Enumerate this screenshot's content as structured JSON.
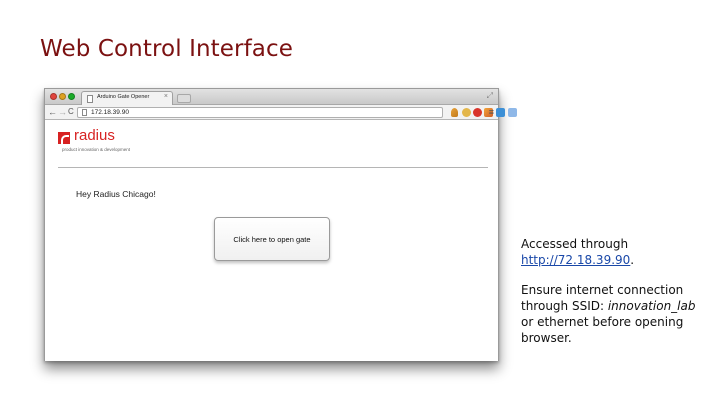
{
  "slide": {
    "title": "Web Control Interface"
  },
  "browser": {
    "tab_title": "Arduino Gate Opener",
    "tab_close": "×",
    "url": "172.18.39.90",
    "nav_back": "←",
    "nav_forward": "→",
    "nav_reload": "C",
    "menu": "≡",
    "expand": "⤢"
  },
  "page": {
    "logo_name": "radius",
    "logo_tagline": "product innovation & development",
    "greeting": "Hey Radius Chicago!",
    "button_label": "Click here to open gate"
  },
  "notes": {
    "line1_prefix": "Accessed through",
    "link_text": "http://72.18.39.90",
    "line1_suffix": ".",
    "line2_prefix": "Ensure internet connection through SSID: ",
    "ssid": "innovation_lab",
    "line2_suffix": " or ethernet before opening browser."
  },
  "colors": {
    "title": "#7b1111",
    "brand_red": "#d72222",
    "link": "#1a48a8"
  }
}
